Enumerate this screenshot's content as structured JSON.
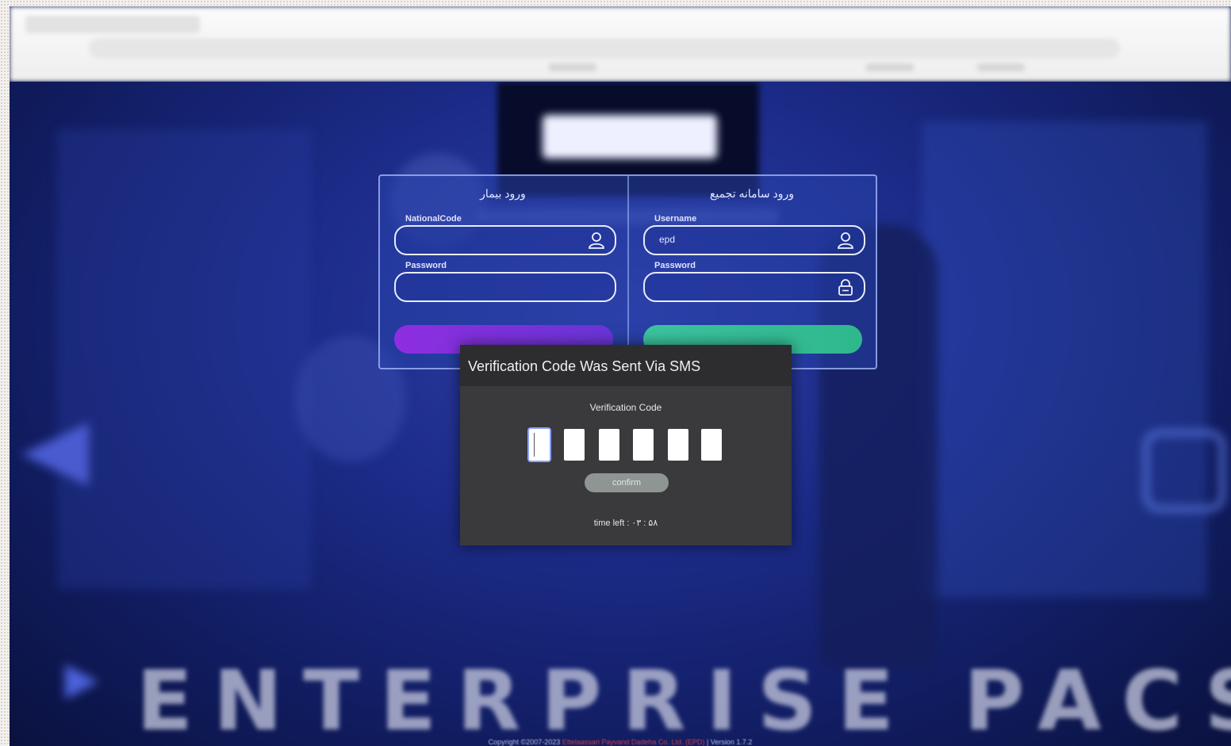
{
  "login": {
    "patient": {
      "title": "ورود بیمار",
      "national_code_label": "NationalCode",
      "national_code_value": "",
      "password_label": "Password"
    },
    "system": {
      "title": "ورود سامانه تجمیع",
      "username_label": "Username",
      "username_value": "epd",
      "password_label": "Password"
    }
  },
  "modal": {
    "title": "Verification Code Was Sent Via SMS",
    "code_label": "Verification Code",
    "confirm_label": "confirm",
    "time_left": "time left : ۰۳ : ۵۸"
  },
  "background": {
    "banner_text": "ENTERPRISE PACS",
    "copyright_prefix": "Copyright ©2007-2023",
    "copyright_company": "Ettelaassari Payvand Dadeha Co. Ltd. (EPD)",
    "copyright_version": "| Version 1.7.2"
  },
  "colors": {
    "patient_button": "#8e2ee0",
    "system_button": "#3cc4a0",
    "modal_bg": "#3a3a3d"
  }
}
